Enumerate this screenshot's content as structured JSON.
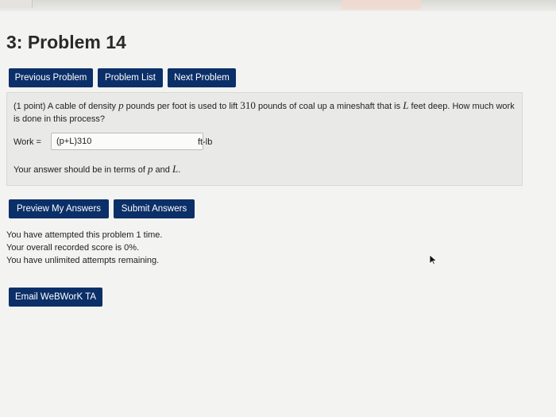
{
  "page": {
    "title": "3: Problem 14"
  },
  "nav": {
    "previous_label": "Previous Problem",
    "list_label": "Problem List",
    "next_label": "Next Problem"
  },
  "problem": {
    "points": "(1 point)",
    "text_1": "A cable of density",
    "var_p": "p",
    "text_2": "pounds per foot is used to lift",
    "weight": "310",
    "text_3": "pounds of coal up a mineshaft that is",
    "var_L": "L",
    "text_4": "feet deep. How much work is done in this process?",
    "work_label": "Work =",
    "answer_value": "(p+L)310",
    "unit": "ft-lb",
    "hint_prefix": "Your answer should be in terms of",
    "hint_var_p": "p",
    "hint_and": "and",
    "hint_var_L": "L",
    "hint_period": "."
  },
  "actions": {
    "preview_label": "Preview My Answers",
    "submit_label": "Submit Answers",
    "email_label": "Email WeBWorK TA"
  },
  "status": {
    "attempts": "You have attempted this problem 1 time.",
    "score": "Your overall recorded score is 0%.",
    "remaining": "You have unlimited attempts remaining."
  },
  "colors": {
    "button_bg": "#0b2f68",
    "page_bg": "#f3f3f1",
    "problem_bg": "#e9e9e7"
  }
}
